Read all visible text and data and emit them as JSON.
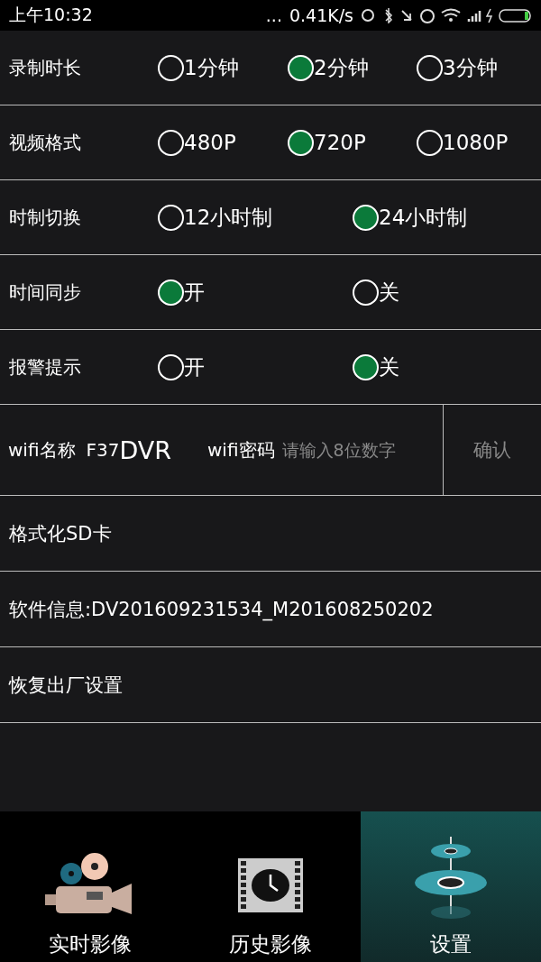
{
  "status_bar": {
    "time": "上午10:32",
    "dots": "...",
    "speed": "0.41K/s"
  },
  "settings": [
    {
      "label": "录制时长",
      "options": [
        {
          "label": "1分钟",
          "selected": false
        },
        {
          "label": "2分钟",
          "selected": true
        },
        {
          "label": "3分钟",
          "selected": false
        }
      ]
    },
    {
      "label": "视频格式",
      "options": [
        {
          "label": "480P",
          "selected": false
        },
        {
          "label": "720P",
          "selected": true
        },
        {
          "label": "1080P",
          "selected": false
        }
      ]
    },
    {
      "label": "时制切换",
      "options": [
        {
          "label": "12小时制",
          "selected": false
        },
        {
          "label": "24小时制",
          "selected": true
        }
      ]
    },
    {
      "label": "时间同步",
      "options": [
        {
          "label": "开",
          "selected": true
        },
        {
          "label": "关",
          "selected": false
        }
      ]
    },
    {
      "label": "报警提示",
      "options": [
        {
          "label": "开",
          "selected": false
        },
        {
          "label": "关",
          "selected": true
        }
      ]
    }
  ],
  "wifi": {
    "name_label": "wifi名称",
    "name_prefix": "F37",
    "name_value": "DVR",
    "password_label": "wifi密码",
    "password_placeholder": "请输入8位数字",
    "confirm": "确认"
  },
  "actions": [
    "格式化SD卡",
    "软件信息:DV201609231534_M201608250202",
    "恢复出厂设置"
  ],
  "tabs": [
    {
      "label": "实时影像",
      "kind": "camera",
      "selected": false
    },
    {
      "label": "历史影像",
      "kind": "film",
      "selected": false
    },
    {
      "label": "设置",
      "kind": "gears",
      "selected": true
    }
  ]
}
